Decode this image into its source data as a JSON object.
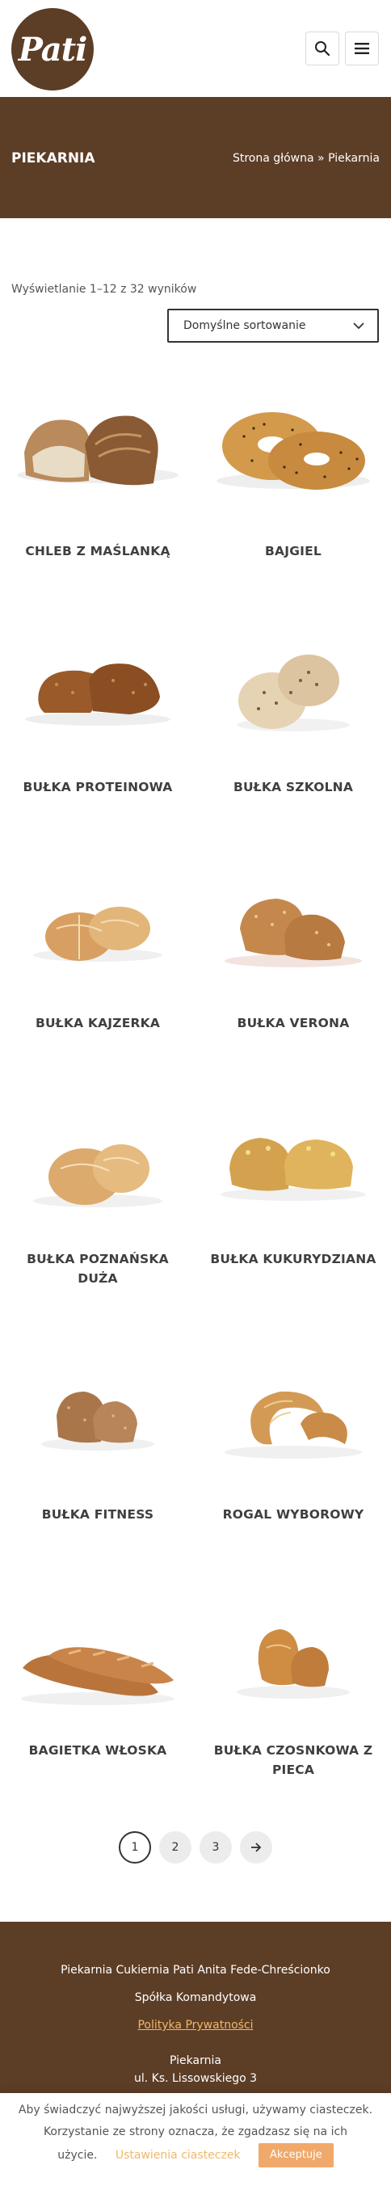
{
  "header": {
    "logo_text": "Pati"
  },
  "titlebar": {
    "title": "PIEKARNIA",
    "breadcrumb_home": "Strona główna",
    "breadcrumb_sep": "»",
    "breadcrumb_current": "Piekarnia"
  },
  "shop": {
    "results_count": "Wyświetlanie 1–12 z 32 wyników",
    "sort_selected": "Domyślne sortowanie"
  },
  "products": [
    {
      "name": "CHLEB Z MAŚLANKĄ"
    },
    {
      "name": "BAJGIEL"
    },
    {
      "name": "BUŁKA PROTEINOWA"
    },
    {
      "name": "BUŁKA SZKOLNA"
    },
    {
      "name": "BUŁKA KAJZERKA"
    },
    {
      "name": "BUŁKA VERONA"
    },
    {
      "name": "BUŁKA POZNAŃSKA DUŻA"
    },
    {
      "name": "BUŁKA KUKURYDZIANA"
    },
    {
      "name": "BUŁKA FITNESS"
    },
    {
      "name": "ROGAL WYBOROWY"
    },
    {
      "name": "BAGIETKA WŁOSKA"
    },
    {
      "name": "BUŁKA CZOSNKOWA Z PIECA"
    }
  ],
  "pagination": {
    "pages": [
      "1",
      "2",
      "3"
    ],
    "current": "1",
    "next_icon": "arrow-right-icon"
  },
  "footer": {
    "company": "Piekarnia Cukiernia Pati Anita Fede-Chreścionko",
    "company_type": "Spółka Komandytowa",
    "privacy_link": "Polityka Prywatności",
    "section": "Piekarnia",
    "address": "ul. Ks. Lissowskiego 3"
  },
  "cookie": {
    "line1": "Aby świadczyć najwyższej jakości usługi, używamy ciasteczek.",
    "line2": "Korzystanie ze strony oznacza, że zgadzasz się na ich",
    "line3": "użycie.",
    "settings_label": "Ustawienia ciasteczek",
    "accept_label": "Akceptuje"
  },
  "colors": {
    "brand_brown": "#5c3d26",
    "accent_orange": "#f0a96b",
    "link_orange": "#f0b86a"
  }
}
